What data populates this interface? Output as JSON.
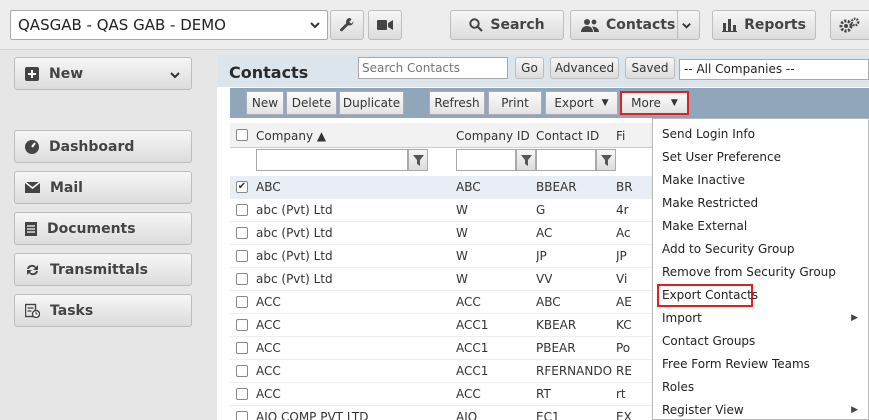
{
  "topbar": {
    "project": "QASGAB - QAS GAB - DEMO",
    "search_label": "Search",
    "contacts_label": "Contacts",
    "reports_label": "Reports"
  },
  "sidebar": {
    "new_label": "New",
    "items": [
      {
        "label": "Dashboard",
        "icon": "dashboard-icon"
      },
      {
        "label": "Mail",
        "icon": "mail-icon"
      },
      {
        "label": "Documents",
        "icon": "documents-icon"
      },
      {
        "label": "Transmittals",
        "icon": "transmittals-icon"
      },
      {
        "label": "Tasks",
        "icon": "tasks-icon"
      }
    ]
  },
  "main": {
    "title": "Contacts",
    "search_placeholder": "Search Contacts",
    "go_label": "Go",
    "advanced_label": "Advanced",
    "saved_label": "Saved",
    "company_filter": "-- All Companies --",
    "toolbar": {
      "new": "New",
      "delete": "Delete",
      "duplicate": "Duplicate",
      "refresh": "Refresh",
      "print": "Print",
      "export": "Export",
      "more": "More"
    },
    "columns": [
      "Company ▲",
      "Company ID",
      "Contact ID",
      "Fi"
    ],
    "rows": [
      {
        "company": "ABC",
        "company_id": "ABC",
        "contact_id": "BBEAR",
        "first": "BR",
        "checked": true
      },
      {
        "company": "abc (Pvt) Ltd",
        "company_id": "W",
        "contact_id": "G",
        "first": "4r",
        "checked": false
      },
      {
        "company": "abc (Pvt) Ltd",
        "company_id": "W",
        "contact_id": "AC",
        "first": "Ac",
        "checked": false
      },
      {
        "company": "abc (Pvt) Ltd",
        "company_id": "W",
        "contact_id": "JP",
        "first": "JP",
        "checked": false
      },
      {
        "company": "abc (Pvt) Ltd",
        "company_id": "W",
        "contact_id": "VV",
        "first": "Vi",
        "checked": false
      },
      {
        "company": "ACC",
        "company_id": "ACC",
        "contact_id": "ABC",
        "first": "AE",
        "checked": false
      },
      {
        "company": "ACC",
        "company_id": "ACC1",
        "contact_id": "KBEAR",
        "first": "KC",
        "checked": false
      },
      {
        "company": "ACC",
        "company_id": "ACC1",
        "contact_id": "PBEAR",
        "first": "Po",
        "checked": false
      },
      {
        "company": "ACC",
        "company_id": "ACC1",
        "contact_id": "RFERNANDO",
        "first": "RE",
        "checked": false
      },
      {
        "company": "ACC",
        "company_id": "ACC",
        "contact_id": "RT",
        "first": "rt",
        "checked": false
      },
      {
        "company": "AIO COMP PVT LTD",
        "company_id": "AIO",
        "contact_id": "EC1",
        "first": "EX",
        "checked": false
      }
    ]
  },
  "more_menu": {
    "items": [
      {
        "label": "Send Login Info",
        "submenu": false
      },
      {
        "label": "Set User Preference",
        "submenu": false
      },
      {
        "label": "Make Inactive",
        "submenu": false
      },
      {
        "label": "Make Restricted",
        "submenu": false
      },
      {
        "label": "Make External",
        "submenu": false
      },
      {
        "label": "Add to Security Group",
        "submenu": false
      },
      {
        "label": "Remove from Security Group",
        "submenu": false
      },
      {
        "label": "Export Contacts",
        "submenu": false,
        "highlighted": true
      },
      {
        "label": "Import",
        "submenu": true
      },
      {
        "label": "Contact Groups",
        "submenu": false
      },
      {
        "label": "Free Form Review Teams",
        "submenu": false
      },
      {
        "label": "Roles",
        "submenu": false
      },
      {
        "label": "Register View",
        "submenu": true
      }
    ]
  },
  "colors": {
    "highlight": "#e02020",
    "toolbar": "#8fa6bb",
    "header": "#dde5ec"
  }
}
